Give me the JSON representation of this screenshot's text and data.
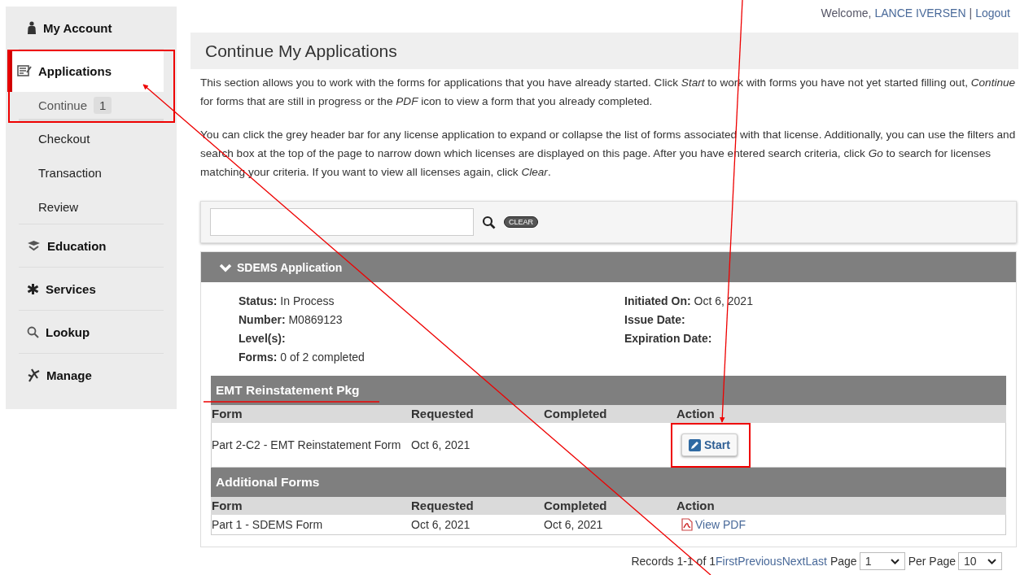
{
  "sidebar": {
    "items": [
      {
        "label": "My Account",
        "selected": false
      },
      {
        "label": "Applications",
        "selected": true,
        "children": [
          {
            "label": "Continue",
            "badge": "1",
            "selected": true
          },
          {
            "label": "Checkout",
            "selected": false
          },
          {
            "label": "Transaction",
            "selected": false
          },
          {
            "label": "Review",
            "selected": false
          }
        ]
      },
      {
        "label": "Education",
        "selected": false
      },
      {
        "label": "Services",
        "selected": false
      },
      {
        "label": "Lookup",
        "selected": false
      },
      {
        "label": "Manage",
        "selected": false
      }
    ]
  },
  "header": {
    "welcome": "Welcome,",
    "user": "LANCE IVERSEN",
    "separator": "|",
    "logout": "Logout"
  },
  "page": {
    "title": "Continue My Applications",
    "paragraphs": [
      "This section allows you to work with the forms for applications that you have already started. Click *Start* to work with forms you have not yet started filling out, *Continue* for forms that are still in progress or the *PDF* icon to view a form that you already completed.",
      "You can click the grey header bar for any license application to expand or collapse the list of forms associated with that license. Additionally, you can use the filters and search box at the top of the page to narrow down which licenses are displayed on this page. After you have entered search criteria, click *Go* to search for licenses matching your criteria. If you want to view all licenses again, click *Clear*."
    ]
  },
  "filter": {
    "clear_button": "CLEAR"
  },
  "application": {
    "title": "SDEMS Application",
    "expanded": true,
    "details_left": [
      "**Status:** In Process",
      "**Number:** M0869123",
      "**Level(s):**",
      "**Forms:** 0 of 2 completed"
    ],
    "details_right": [
      "**Initiated On:** Oct 6, 2021",
      "**Issue Date:**",
      "**Expiration Date:**"
    ],
    "groups": [
      {
        "title": "EMT Reinstatement Pkg",
        "columns": [
          "Form",
          "Requested",
          "Completed",
          "Action"
        ],
        "rows": [
          {
            "form": "Part 2-C2 - EMT Reinstatement Form",
            "requested": "Oct 6, 2021",
            "completed": "",
            "action": {
              "kind": "button",
              "label": "Start"
            }
          }
        ]
      },
      {
        "title": "Additional Forms",
        "columns": [
          "Form",
          "Requested",
          "Completed",
          "Action"
        ],
        "rows": [
          {
            "form": "Part 1 - SDEMS Form",
            "requested": "Oct 6, 2021",
            "completed": "Oct 6, 2021",
            "action": {
              "kind": "pdf",
              "label": "View PDF"
            }
          }
        ]
      }
    ]
  },
  "pagination": {
    "records": "Records 1-1 of 1",
    "links": [
      "First",
      "Previous",
      "Next",
      "Last"
    ],
    "page_label": "Page",
    "page": "1",
    "per_page_label": "Per Page",
    "per_page": "10"
  }
}
